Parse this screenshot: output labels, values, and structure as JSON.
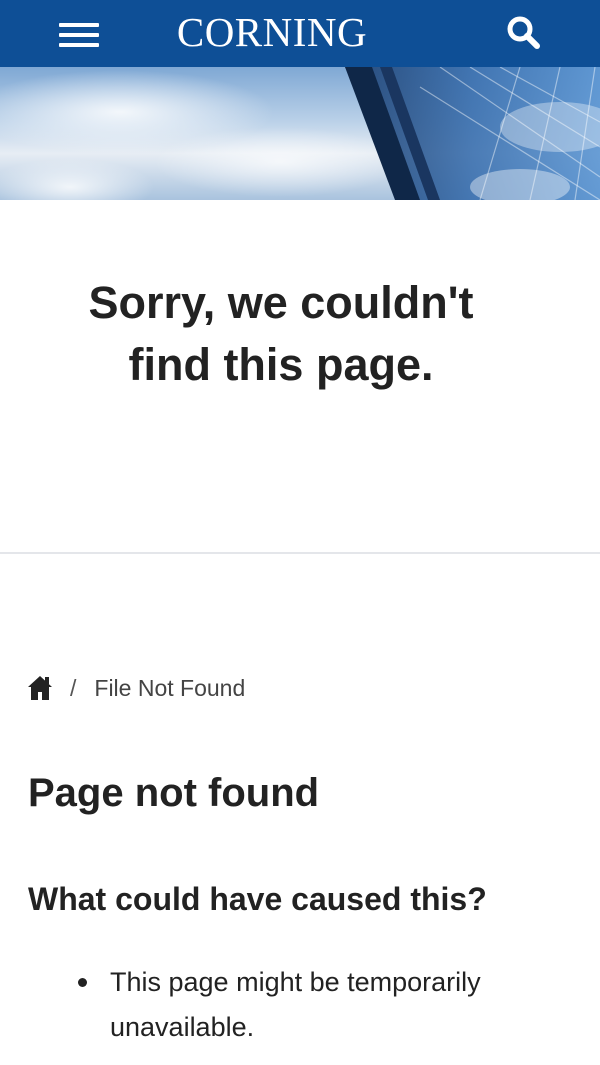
{
  "header": {
    "logo_text": "CORNING",
    "menu_icon": "hamburger-menu-icon",
    "search_icon": "search-icon",
    "background_color": "#0e4f96"
  },
  "hero": {
    "image": "sky-and-glass-building"
  },
  "error": {
    "title": "Sorry, we couldn't find this page."
  },
  "breadcrumb": {
    "home_icon": "home-icon",
    "separator": "/",
    "current": "File Not Found"
  },
  "content": {
    "page_heading": "Page not found",
    "sub_heading": "What could have caused this?",
    "reasons": [
      "This page might be temporarily unavailable."
    ]
  }
}
